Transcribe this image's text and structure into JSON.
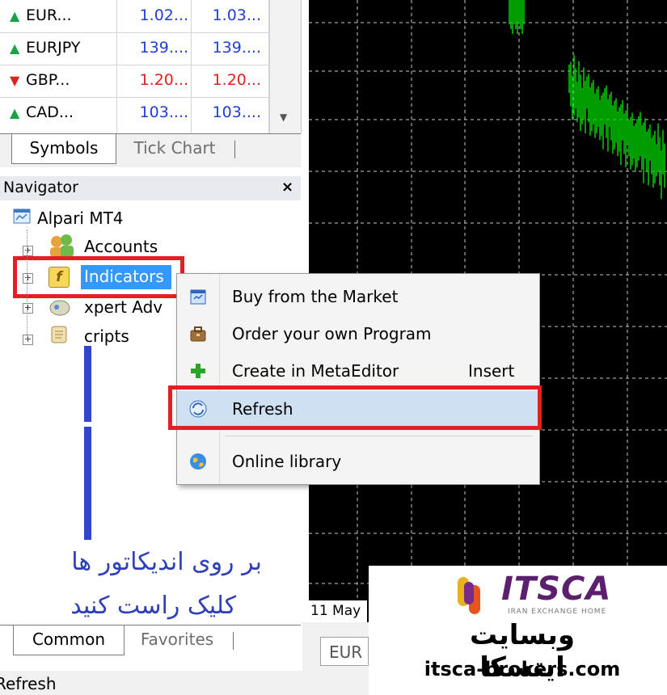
{
  "market_watch": {
    "rows": [
      {
        "symbol": "EUR...",
        "bid": "1.02...",
        "ask": "1.03...",
        "direction": "up",
        "color": "blue"
      },
      {
        "symbol": "EURJPY",
        "bid": "139....",
        "ask": "139....",
        "direction": "up",
        "color": "blue"
      },
      {
        "symbol": "GBP...",
        "bid": "1.20...",
        "ask": "1.20...",
        "direction": "down",
        "color": "red"
      },
      {
        "symbol": "CAD...",
        "bid": "103....",
        "ask": "103....",
        "direction": "up",
        "color": "blue"
      }
    ],
    "tabs": [
      {
        "label": "Symbols",
        "active": true
      },
      {
        "label": "Tick Chart",
        "active": false
      }
    ]
  },
  "navigator": {
    "title": "Navigator",
    "close": "×",
    "root": "Alpari MT4",
    "items": [
      {
        "label": "Accounts",
        "icon": "accounts-icon"
      },
      {
        "label": "Indicators",
        "icon": "indicators-icon"
      },
      {
        "label": "xpert Adv",
        "icon": "expert-advisors-icon"
      },
      {
        "label": "cripts",
        "icon": "scripts-icon"
      }
    ],
    "tabs": [
      {
        "label": "Common",
        "active": true
      },
      {
        "label": "Favorites",
        "active": false
      }
    ]
  },
  "context_menu": {
    "items": [
      {
        "label": "Buy from the Market",
        "icon": "market-icon",
        "shortcut": ""
      },
      {
        "label": "Order your own Program",
        "icon": "briefcase-icon",
        "shortcut": ""
      },
      {
        "label": "Create in MetaEditor",
        "icon": "green-plus-icon",
        "shortcut": "Insert"
      },
      {
        "label": "Refresh",
        "icon": "refresh-icon",
        "shortcut": ""
      },
      {
        "label": "Online library",
        "icon": "globe-icon",
        "shortcut": ""
      }
    ]
  },
  "chart": {
    "date_label": "11 May",
    "tab_label": "EUR",
    "grid_color": "#c8c8c8",
    "candle_color": "#00d000"
  },
  "annotation": {
    "line1": "بر روی اندیکاتور ها",
    "line2": "کلیک راست کنید",
    "color": "#2f3fb8"
  },
  "logo": {
    "brand": "ITSCA",
    "tagline": "IRAN EXCHANGE HOME",
    "persian": "وبسایت ایتسکا",
    "url": "itsca-brokers.com"
  },
  "status_bar": {
    "text": "Refresh"
  },
  "colors": {
    "highlight_red": "#e31e24",
    "selection_blue": "#3399ff"
  }
}
